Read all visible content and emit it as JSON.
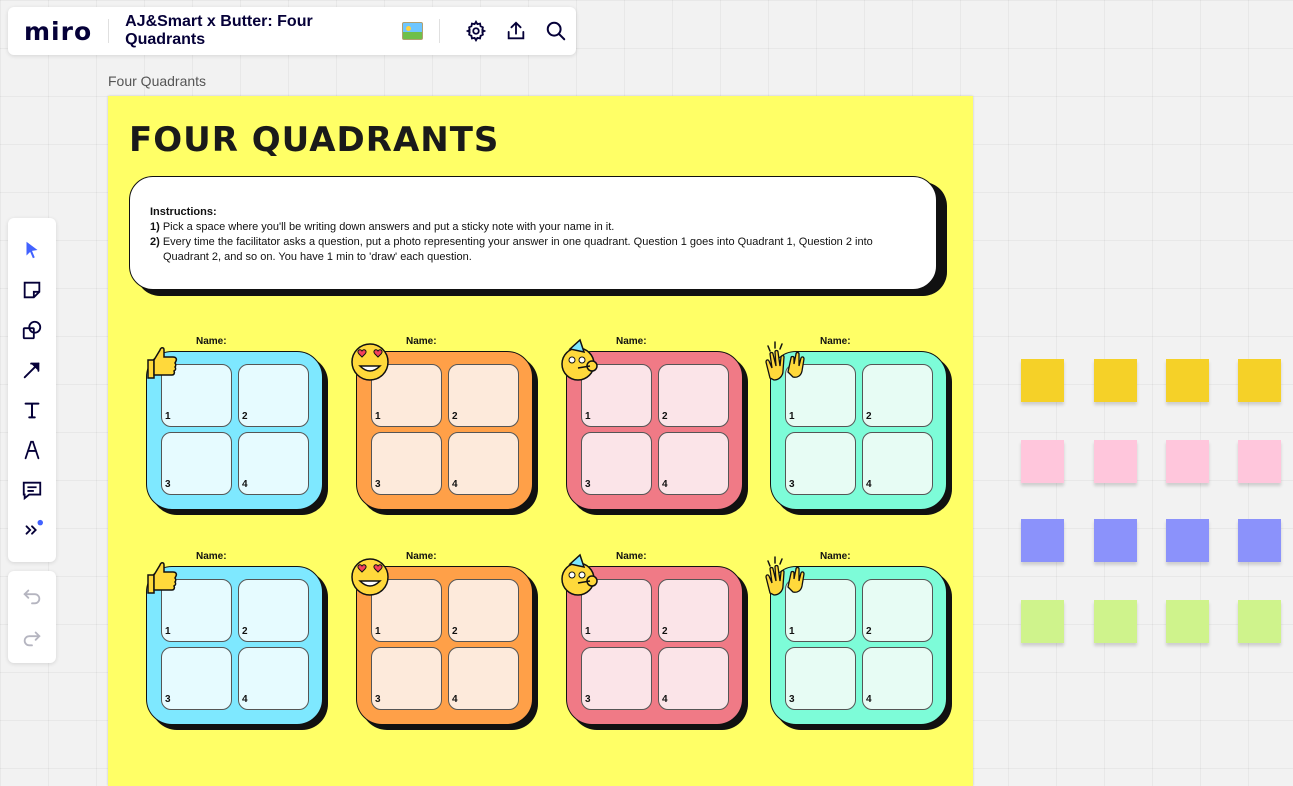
{
  "app": {
    "logo": "miro",
    "board_title": "AJ&Smart x Butter: Four Quadrants"
  },
  "frame": {
    "label": "Four Quadrants",
    "title": "FOUR QUADRANTS"
  },
  "instructions": {
    "heading": "Instructions:",
    "items": [
      {
        "num": "1)",
        "text": "Pick a space where you'll be writing down answers and put a sticky note with your name in it."
      },
      {
        "num": "2)",
        "text": "Every time the facilitator asks a question, put a photo representing your answer in one quadrant. Question 1 goes into Quadrant 1, Question 2 into Quadrant 2, and so on. You have 1 min to 'draw' each question."
      }
    ]
  },
  "quadrant_name_label": "Name:",
  "quadrant_numbers": [
    "1",
    "2",
    "3",
    "4"
  ],
  "quadrant_cards": [
    {
      "color": "#7ee8ff",
      "cell": "#e6fbff",
      "emoji": "thumbs-up-icon"
    },
    {
      "color": "#ffa048",
      "cell": "#fdeadb",
      "emoji": "heart-eyes-emoji-icon"
    },
    {
      "color": "#f07a86",
      "cell": "#fbe4e8",
      "emoji": "party-emoji-icon"
    },
    {
      "color": "#7dfcd8",
      "cell": "#e7fcf4",
      "emoji": "clapping-hands-icon"
    }
  ],
  "sticky_colors": [
    "#f5d128",
    "#ffc6dc",
    "#8b92fb",
    "#cff38c"
  ],
  "icons": {
    "settings": "gear-icon",
    "export": "upload-icon",
    "search": "search-icon",
    "select": "cursor-icon",
    "sticky": "sticky-note-icon",
    "shapes": "shapes-icon",
    "connector": "arrow-icon",
    "text": "text-icon",
    "pen": "pen-icon",
    "comment": "comment-icon",
    "more": "more-tools-icon",
    "undo": "undo-icon",
    "redo": "redo-icon"
  },
  "colors": {
    "accent": "#4262ff",
    "frame_bg": "#ffff66"
  }
}
